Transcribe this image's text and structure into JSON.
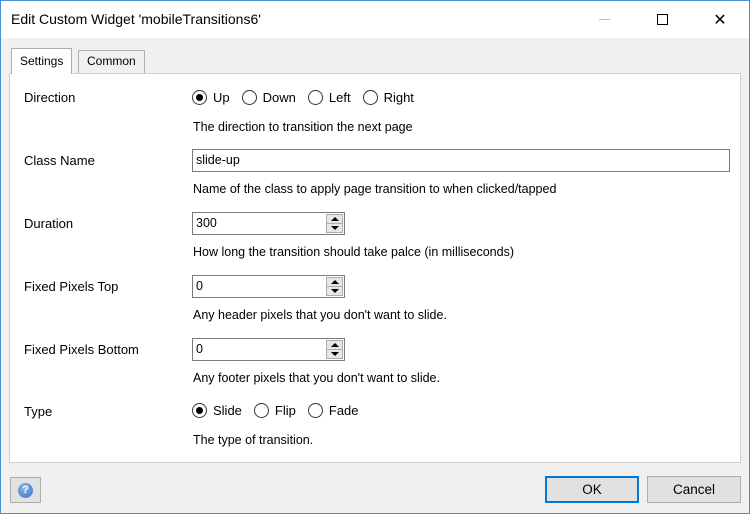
{
  "window": {
    "title": "Edit Custom Widget 'mobileTransitions6'",
    "controls": {
      "minimize_icon": "minimize-icon",
      "maximize_icon": "maximize-icon",
      "close_icon": "close-icon",
      "close_glyph": "✕"
    }
  },
  "tabs": [
    {
      "label": "Settings",
      "active": true
    },
    {
      "label": "Common",
      "active": false
    }
  ],
  "fields": {
    "direction": {
      "label": "Direction",
      "options": [
        "Up",
        "Down",
        "Left",
        "Right"
      ],
      "selected": "Up",
      "description": "The direction to transition the next page"
    },
    "class_name": {
      "label": "Class Name",
      "value": "slide-up",
      "description": "Name of the class to apply page transition to when clicked/tapped"
    },
    "duration": {
      "label": "Duration",
      "value": "300",
      "description": "How long the transition should take palce (in milliseconds)"
    },
    "fixed_top": {
      "label": "Fixed Pixels Top",
      "value": "0",
      "description": "Any header pixels that you don't want to slide."
    },
    "fixed_bottom": {
      "label": "Fixed Pixels Bottom",
      "value": "0",
      "description": "Any footer pixels that you don't want to slide."
    },
    "type": {
      "label": "Type",
      "options": [
        "Slide",
        "Flip",
        "Fade"
      ],
      "selected": "Slide",
      "description": "The type of transition."
    }
  },
  "footer": {
    "help_glyph": "?",
    "ok_label": "OK",
    "cancel_label": "Cancel"
  },
  "colors": {
    "accent": "#0078d7",
    "window_border": "#4a90d9",
    "dialog_bg": "#f0f0f0"
  }
}
